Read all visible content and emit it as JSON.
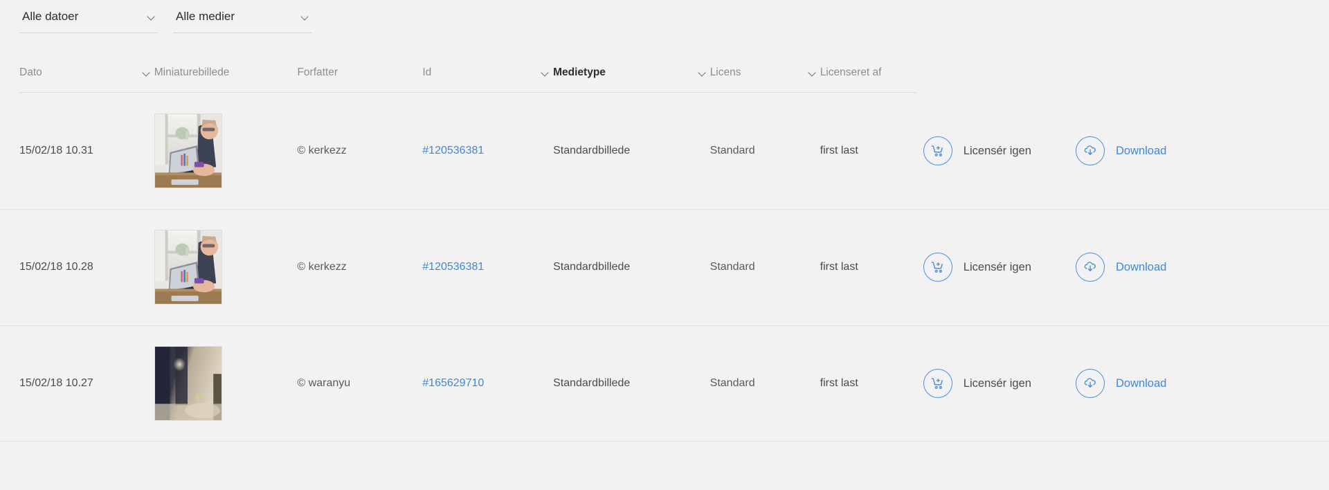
{
  "filters": [
    {
      "label": "Alle datoer",
      "icon": "chevron-down-icon"
    },
    {
      "label": "Alle medier",
      "icon": "chevron-down-icon"
    }
  ],
  "table": {
    "columns": [
      {
        "key": "date",
        "label": "Dato",
        "sortable": true,
        "active": false
      },
      {
        "key": "thumb",
        "label": "Miniaturebillede",
        "sortable": false,
        "active": false
      },
      {
        "key": "author",
        "label": "Forfatter",
        "sortable": false,
        "active": false
      },
      {
        "key": "id",
        "label": "Id",
        "sortable": true,
        "active": false
      },
      {
        "key": "type",
        "label": "Medietype",
        "sortable": true,
        "active": true
      },
      {
        "key": "license",
        "label": "Licens",
        "sortable": true,
        "active": false
      },
      {
        "key": "licensed",
        "label": "Licenseret af",
        "sortable": false,
        "active": false
      }
    ],
    "rows": [
      {
        "date": "15/02/18 10.31",
        "thumbnail": "person-at-laptop-by-window",
        "author": "© kerkezz",
        "id": "#120536381",
        "type": "Standardbillede",
        "license": "Standard",
        "licensed_by": "first last",
        "relicense_label": "Licensér igen",
        "relicense_icon": "cart-plus-icon",
        "download_label": "Download",
        "download_icon": "cloud-download-icon"
      },
      {
        "date": "15/02/18 10.28",
        "thumbnail": "person-at-laptop-by-window",
        "author": "© kerkezz",
        "id": "#120536381",
        "type": "Standardbillede",
        "license": "Standard",
        "licensed_by": "first last",
        "relicense_label": "Licensér igen",
        "relicense_icon": "cart-plus-icon",
        "download_label": "Download",
        "download_icon": "cloud-download-icon"
      },
      {
        "date": "15/02/18 10.27",
        "thumbnail": "dark-blurred-interior",
        "author": "© waranyu",
        "id": "#165629710",
        "type": "Standardbillede",
        "license": "Standard",
        "licensed_by": "first last",
        "relicense_label": "Licensér igen",
        "relicense_icon": "cart-plus-icon",
        "download_label": "Download",
        "download_icon": "cloud-download-icon"
      }
    ]
  },
  "colors": {
    "background": "#f2f2f2",
    "accent_blue": "#3f87d6",
    "icon_blue": "#4a91dd",
    "text_primary": "#2c2c2c",
    "text_secondary": "#4b4b4b",
    "text_muted": "#8e8e8e",
    "divider": "#e2e2e2"
  }
}
